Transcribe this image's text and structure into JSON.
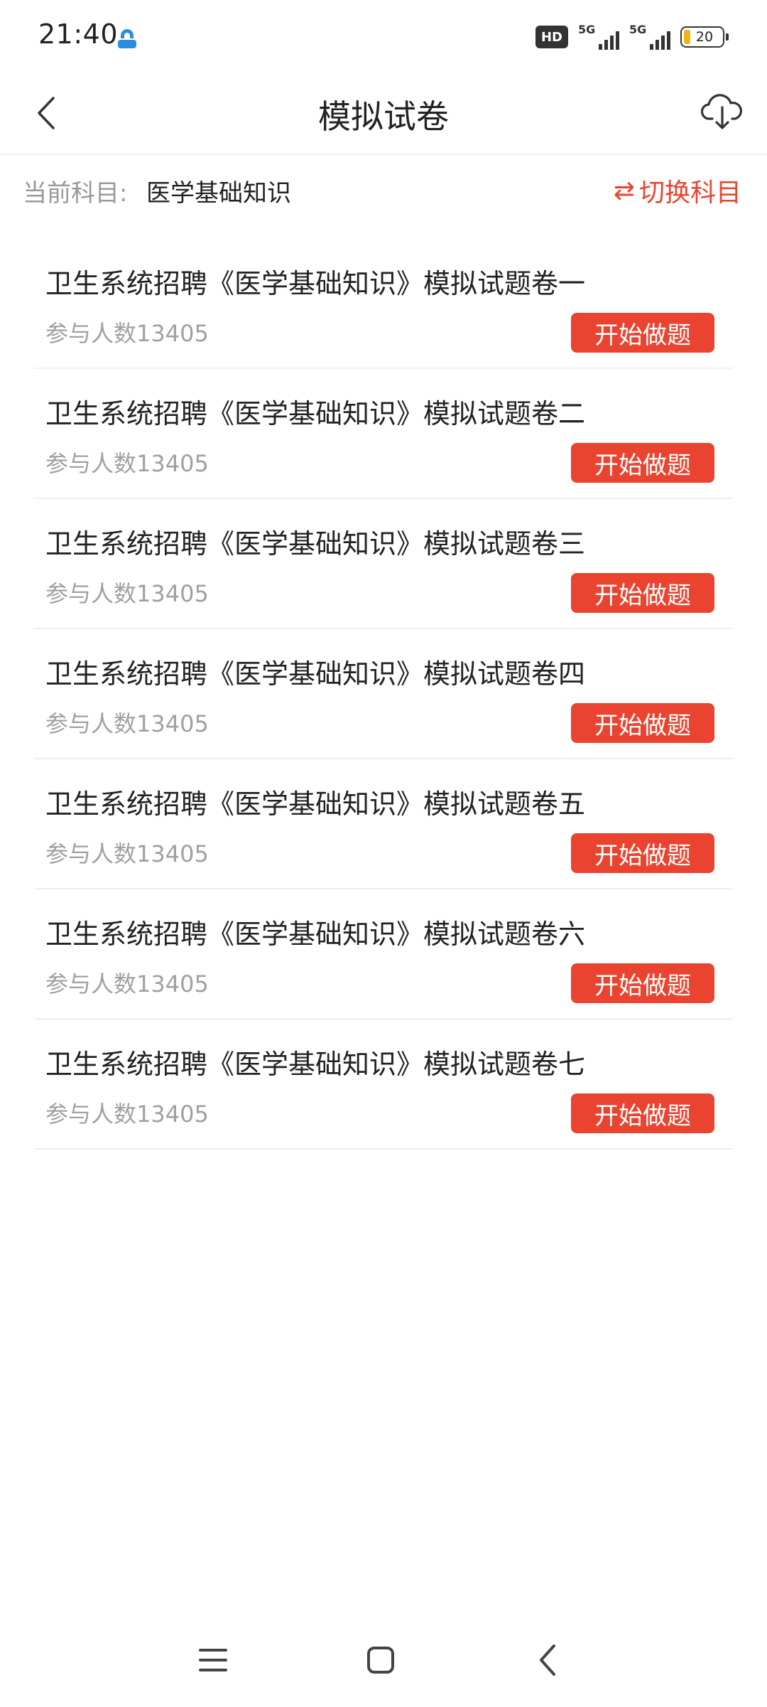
{
  "status_bar": {
    "time": "21:40",
    "hd_label": "HD",
    "network_1": "5G",
    "network_2": "5G",
    "battery": "20",
    "battery_color": "#f2b318"
  },
  "header": {
    "title": "模拟试卷",
    "back_icon": "chevron-left-icon",
    "download_icon": "cloud-download-icon"
  },
  "subject": {
    "label": "当前科目:",
    "name": "医学基础知识",
    "switch_icon": "⇄",
    "switch_label": "切换科目"
  },
  "papers": [
    {
      "title": "卫生系统招聘《医学基础知识》模拟试题卷一",
      "count": "参与人数13405",
      "button": "开始做题"
    },
    {
      "title": "卫生系统招聘《医学基础知识》模拟试题卷二",
      "count": "参与人数13405",
      "button": "开始做题"
    },
    {
      "title": "卫生系统招聘《医学基础知识》模拟试题卷三",
      "count": "参与人数13405",
      "button": "开始做题"
    },
    {
      "title": "卫生系统招聘《医学基础知识》模拟试题卷四",
      "count": "参与人数13405",
      "button": "开始做题"
    },
    {
      "title": "卫生系统招聘《医学基础知识》模拟试题卷五",
      "count": "参与人数13405",
      "button": "开始做题"
    },
    {
      "title": "卫生系统招聘《医学基础知识》模拟试题卷六",
      "count": "参与人数13405",
      "button": "开始做题"
    },
    {
      "title": "卫生系统招聘《医学基础知识》模拟试题卷七",
      "count": "参与人数13405",
      "button": "开始做题"
    }
  ],
  "colors": {
    "accent": "#ea4430",
    "muted_text": "#999999",
    "divider": "#efefef"
  }
}
